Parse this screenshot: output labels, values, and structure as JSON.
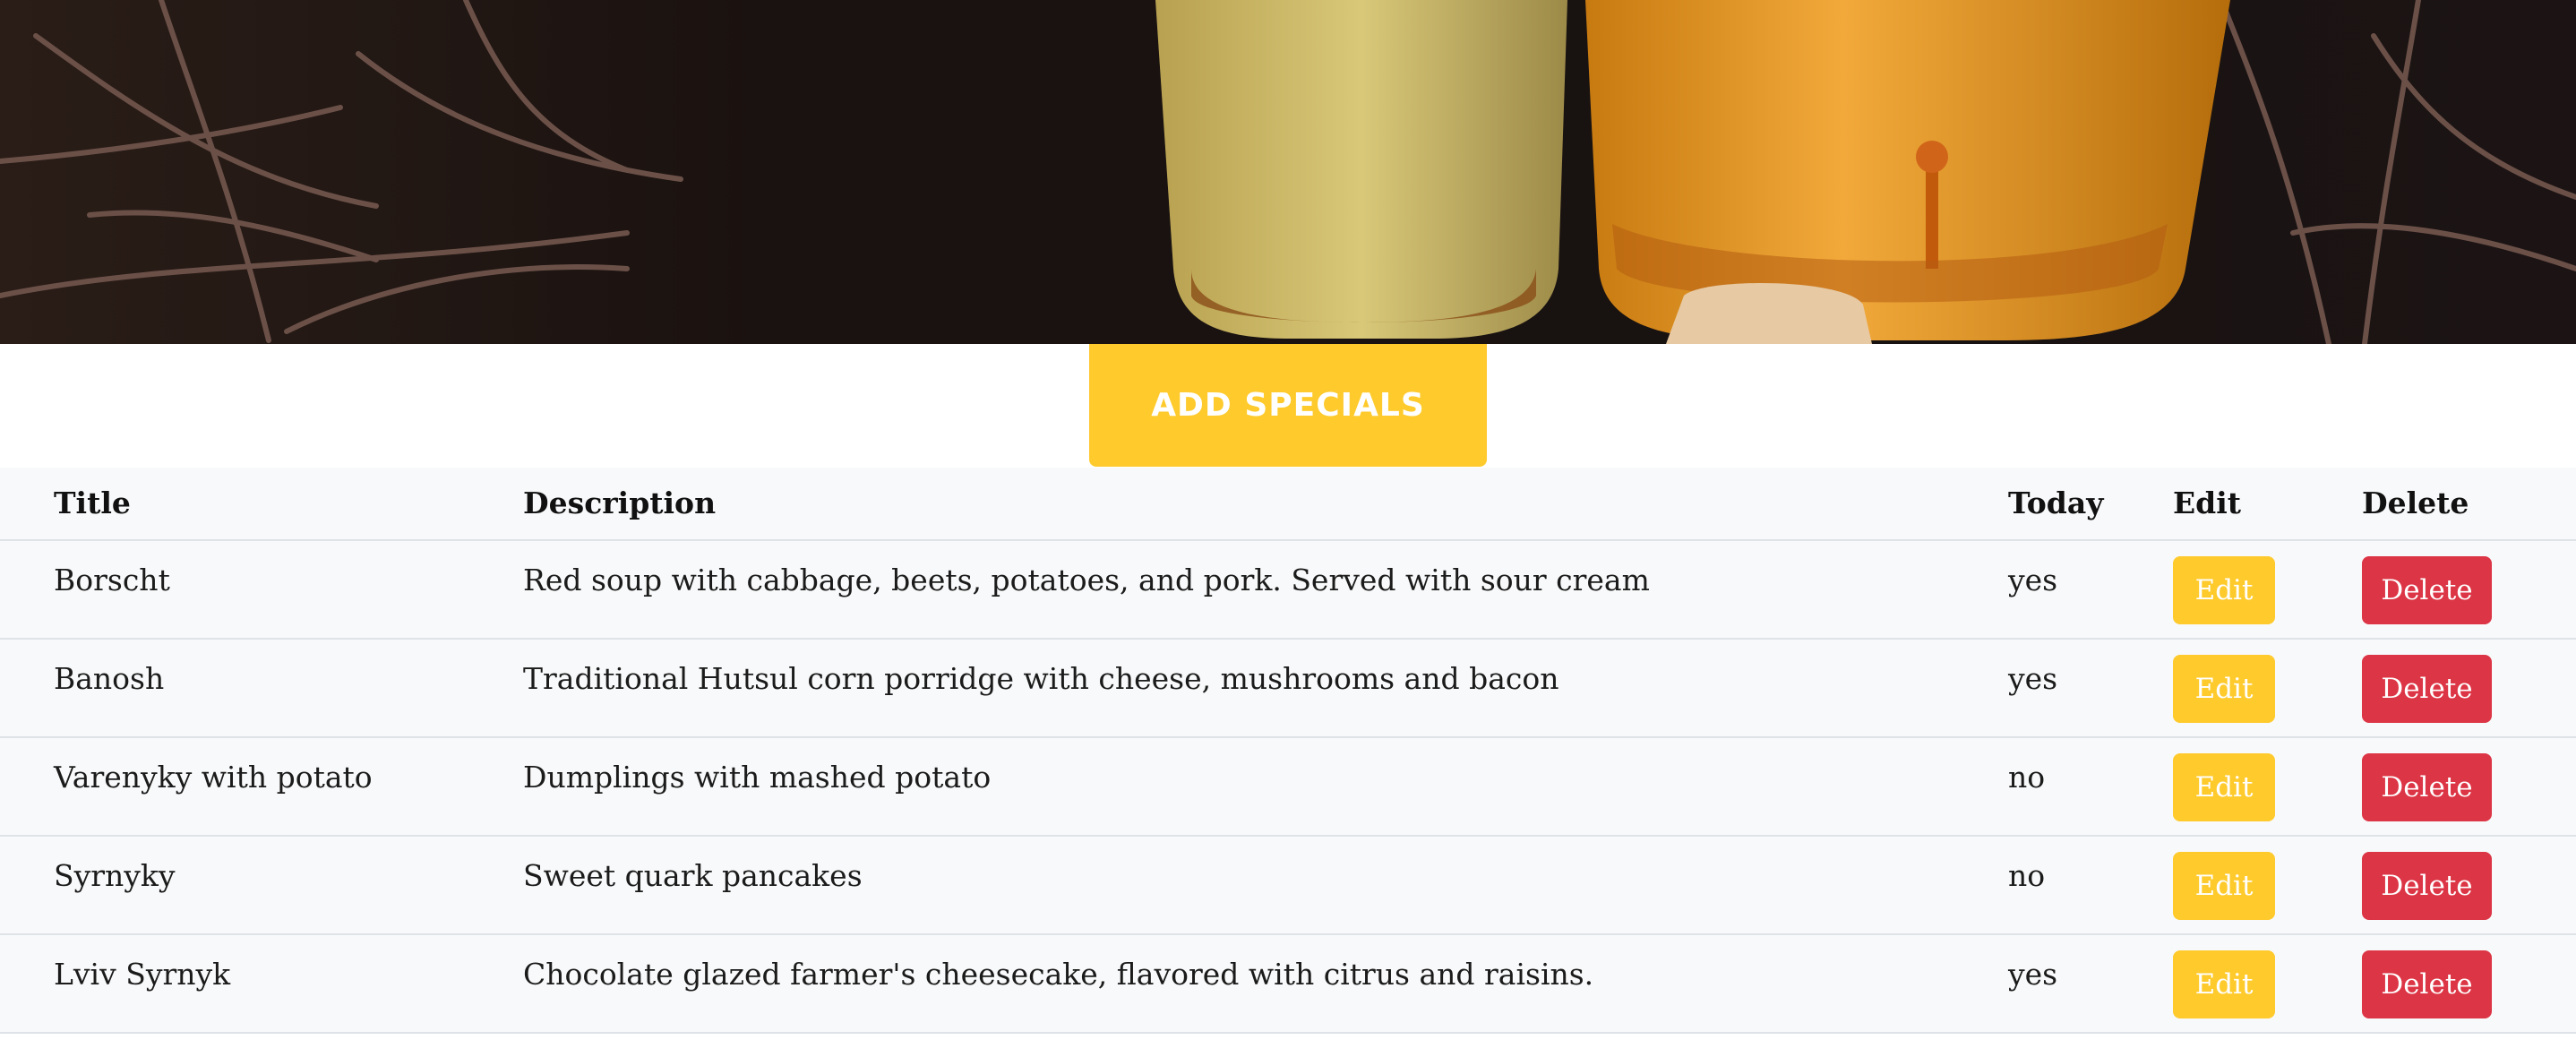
{
  "actions": {
    "add_label": "ADD SPECIALS"
  },
  "table": {
    "headers": {
      "title": "Title",
      "description": "Description",
      "today": "Today",
      "edit": "Edit",
      "delete": "Delete"
    },
    "rows": [
      {
        "title": "Borscht",
        "description": "Red soup with cabbage, beets, potatoes, and pork. Served with sour cream",
        "today": "yes",
        "edit_label": "Edit",
        "delete_label": "Delete"
      },
      {
        "title": "Banosh",
        "description": "Traditional Hutsul corn porridge with cheese, mushrooms and bacon",
        "today": "yes",
        "edit_label": "Edit",
        "delete_label": "Delete"
      },
      {
        "title": "Varenyky with potato",
        "description": "Dumplings with mashed potato",
        "today": "no",
        "edit_label": "Edit",
        "delete_label": "Delete"
      },
      {
        "title": "Syrnyky",
        "description": "Sweet quark pancakes",
        "today": "no",
        "edit_label": "Edit",
        "delete_label": "Delete"
      },
      {
        "title": "Lviv Syrnyk",
        "description": "Chocolate glazed farmer's cheesecake, flavored with citrus and raisins.",
        "today": "yes",
        "edit_label": "Edit",
        "delete_label": "Delete"
      }
    ]
  },
  "colors": {
    "accent": "#ffca2c",
    "danger": "#dc3545",
    "table_bg": "#f8f9fa"
  }
}
